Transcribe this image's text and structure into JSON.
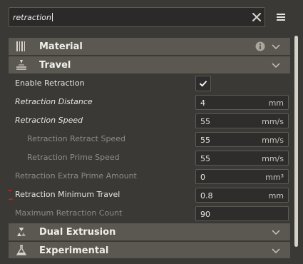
{
  "search": {
    "value": "retraction"
  },
  "categories": {
    "material": {
      "label": "Material"
    },
    "travel": {
      "label": "Travel"
    },
    "dual_extrusion": {
      "label": "Dual Extrusion"
    },
    "experimental": {
      "label": "Experimental"
    }
  },
  "settings": [
    {
      "label": "Enable Retraction",
      "value": "",
      "unit": "",
      "checked": true
    },
    {
      "label": "Retraction Distance",
      "value": "4",
      "unit": "mm"
    },
    {
      "label": "Retraction Speed",
      "value": "55",
      "unit": "mm/s"
    },
    {
      "label": "Retraction Retract Speed",
      "value": "55",
      "unit": "mm/s"
    },
    {
      "label": "Retraction Prime Speed",
      "value": "55",
      "unit": "mm/s"
    },
    {
      "label": "Retraction Extra Prime Amount",
      "value": "0",
      "unit": "mm³"
    },
    {
      "label": "Retraction Minimum Travel",
      "value": "0.8",
      "unit": "mm"
    },
    {
      "label": "Maximum Retraction Count",
      "value": "90",
      "unit": ""
    }
  ]
}
